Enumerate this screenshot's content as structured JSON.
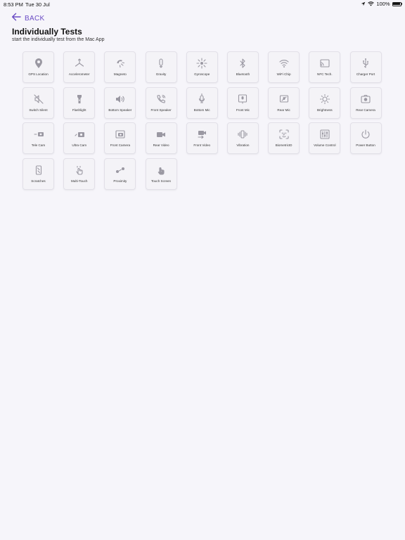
{
  "status_bar": {
    "time": "8:53 PM",
    "date": "Tue 30 Jul",
    "battery": "100%",
    "icons": [
      "location-arrow-icon",
      "wifi-icon",
      "battery-icon"
    ]
  },
  "header": {
    "back_label": "BACK",
    "title": "Individually Tests",
    "subtitle": "start the individually test from the Mac App"
  },
  "colors": {
    "accent": "#6a4bc4",
    "background": "#f6f5fa",
    "tile_background": "#f4f3f7",
    "tile_border": "#e2e0e8",
    "icon": "#9a98a2"
  },
  "tests": [
    {
      "label": "GPS Location",
      "icon": "location-pin-icon"
    },
    {
      "label": "Accelerometer",
      "icon": "accelerometer-icon"
    },
    {
      "label": "Magneto",
      "icon": "magnet-icon"
    },
    {
      "label": "Gravity",
      "icon": "gravity-icon"
    },
    {
      "label": "Gyroscope",
      "icon": "gyroscope-icon"
    },
    {
      "label": "Bluetooth",
      "icon": "bluetooth-icon"
    },
    {
      "label": "WiFi Chip",
      "icon": "wifi-icon"
    },
    {
      "label": "NFC Tech.",
      "icon": "nfc-icon"
    },
    {
      "label": "Charger Port",
      "icon": "usb-icon"
    },
    {
      "label": "Switch Silent",
      "icon": "mute-icon"
    },
    {
      "label": "Flashlight",
      "icon": "flashlight-icon"
    },
    {
      "label": "Bottom Speaker",
      "icon": "speaker-icon"
    },
    {
      "label": "Front Speaker",
      "icon": "phone-speaker-icon"
    },
    {
      "label": "Bottom Mic",
      "icon": "bottom-mic-icon"
    },
    {
      "label": "Front Mic",
      "icon": "front-mic-icon"
    },
    {
      "label": "Rear Mic",
      "icon": "rear-mic-icon"
    },
    {
      "label": "Brightness",
      "icon": "sun-icon"
    },
    {
      "label": "Rear Camera",
      "icon": "rear-camera-icon"
    },
    {
      "label": "Tele Cam",
      "icon": "tele-camera-icon"
    },
    {
      "label": "Ultra Cam",
      "icon": "ultra-camera-icon"
    },
    {
      "label": "Front Camera",
      "icon": "front-camera-icon"
    },
    {
      "label": "Rear Video",
      "icon": "video-camera-icon"
    },
    {
      "label": "Front Video",
      "icon": "front-video-icon"
    },
    {
      "label": "Vibration",
      "icon": "vibration-icon"
    },
    {
      "label": "BiometricID",
      "icon": "face-id-icon"
    },
    {
      "label": "Volume Control",
      "icon": "sliders-icon"
    },
    {
      "label": "Power Button",
      "icon": "power-icon"
    },
    {
      "label": "Scratches",
      "icon": "phone-scratch-icon"
    },
    {
      "label": "Multi-Touch",
      "icon": "multi-touch-icon"
    },
    {
      "label": "Proximity",
      "icon": "proximity-icon"
    },
    {
      "label": "Touch Screen",
      "icon": "touch-icon"
    }
  ]
}
